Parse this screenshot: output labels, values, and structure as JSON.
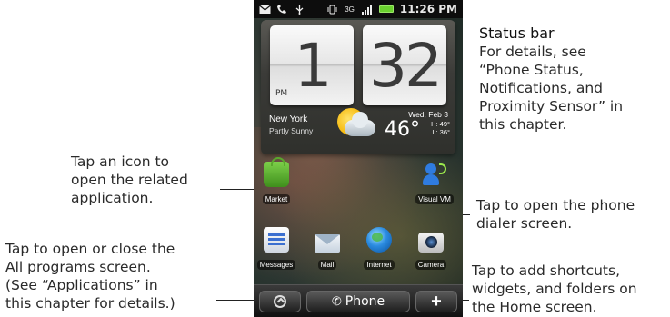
{
  "status_bar": {
    "time": "11:26 PM",
    "network": "3G",
    "icons": [
      "mail-icon",
      "missed-call-icon",
      "usb-icon",
      "vibrate-icon",
      "signal-icon",
      "battery-icon"
    ]
  },
  "clock_widget": {
    "hour": "1",
    "minute": "32",
    "ampm": "PM",
    "city": "New York",
    "condition": "Partly Sunny",
    "date": "Wed, Feb 3",
    "temperature": "46°",
    "high": "H: 49°",
    "low": "L: 36°"
  },
  "apps": [
    {
      "label": "Market",
      "icon": "market-icon"
    },
    {
      "label": "Visual VM",
      "icon": "visual-voicemail-icon"
    },
    {
      "label": "Messages",
      "icon": "messages-icon"
    },
    {
      "label": "Mail",
      "icon": "mail-app-icon"
    },
    {
      "label": "Internet",
      "icon": "internet-globe-icon"
    },
    {
      "label": "Camera",
      "icon": "camera-icon"
    }
  ],
  "bottom_bar": {
    "phone_label": "Phone",
    "add_label": "+"
  },
  "callouts": {
    "status_bar_title": "Status bar",
    "status_bar_body": "For details, see\n“Phone Status,\nNotifications, and\nProximity Sensor” in\nthis chapter.",
    "tap_icon": "Tap an icon to\nopen the related\napplication.",
    "all_programs": "Tap to open or close the\nAll programs screen.\n(See “Applications” in\nthis chapter for details.)",
    "phone_dialer": "Tap to open the phone\ndialer screen.",
    "add_shortcuts": "Tap to add shortcuts,\nwidgets, and folders on\nthe Home screen."
  }
}
